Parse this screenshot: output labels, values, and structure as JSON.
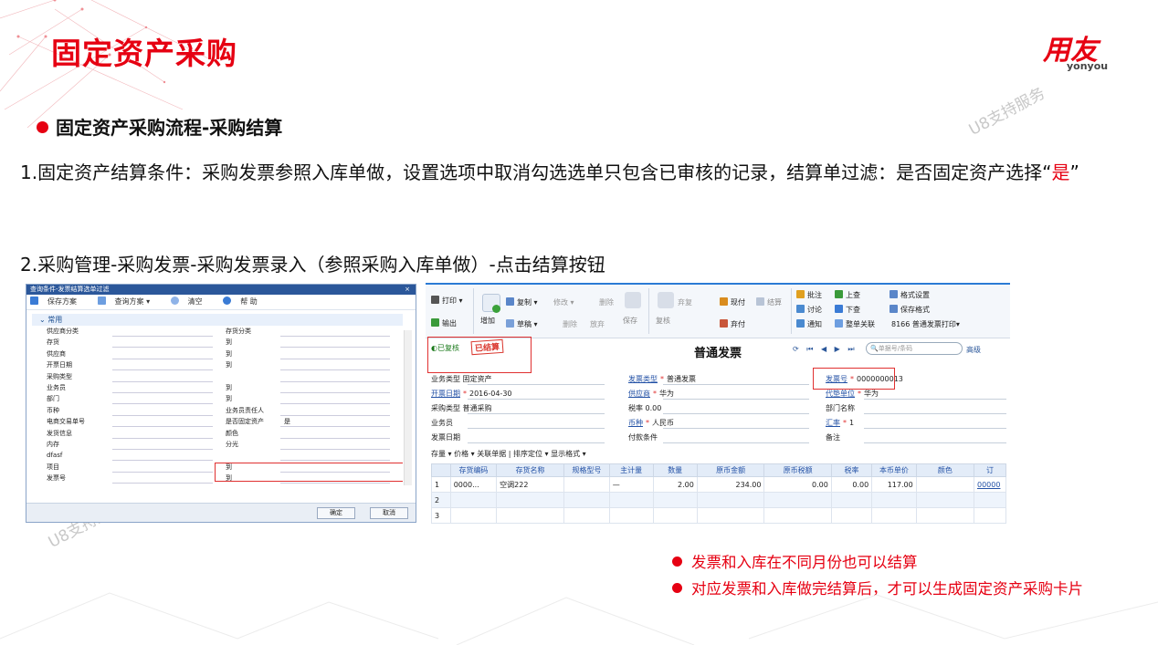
{
  "slide": {
    "title": "固定资产采购",
    "logo_cn": "用友",
    "logo_en": "yonyou",
    "section": "固定资产采购流程-采购结算",
    "para1_text": "1.固定资产结算条件：采购发票参照入库单做，设置选项中取消勾选选单只包含已审核的记录，结算单过滤：是否固定资产选择“",
    "para1_red": "是",
    "para1_end": "”",
    "para2": "2.采购管理-采购发票-采购发票录入（参照采购入库单做）-点击结算按钮",
    "watermark": "U8支持服务",
    "notes": [
      "发票和入库在不同月份也可以结算",
      "对应发票和入库做完结算后，才可以生成固定资产采购卡片"
    ]
  },
  "dialog": {
    "title": "查询条件-发票结算选单过滤",
    "close": "×",
    "toolbar": [
      "保存方案",
      "查询方案 ▾",
      "清空",
      "帮 助"
    ],
    "group": "常用",
    "fields_left": [
      "供应商分类",
      "存货",
      "供应商",
      "开票日期",
      "采购类型",
      "业务员",
      "部门",
      "币种",
      "电商交易单号",
      "发货信息",
      "内存",
      "dfasf",
      "项目",
      "发票号"
    ],
    "fields_right": [
      "存货分类",
      "到",
      "到",
      "到",
      "",
      "到",
      "到",
      "业务员责任人",
      "是否固定资产",
      "颜色",
      "分光",
      "",
      "到",
      "到"
    ],
    "fixed_asset_value": "是",
    "ok": "确定",
    "cancel": "取消"
  },
  "window": {
    "toolbar": {
      "print": "打印 ▾",
      "export": "输出",
      "add": "增加",
      "copy": "复制 ▾",
      "draft": "草稿 ▾",
      "modify": "修改 ▾",
      "delete": "删除",
      "delete2": "删除",
      "abandon": "放弃",
      "save": "保存",
      "audit": "复核",
      "unaudit": "弃复",
      "cash": "现付",
      "settle": "结算",
      "abandon_pay": "弃付",
      "approve": "批注",
      "discuss": "讨论",
      "notify": "通知",
      "prev": "上查",
      "next": "下查",
      "whole": "整单关联",
      "fmt_set": "格式设置",
      "fmt_save": "保存格式",
      "print_tpl": "8166 普通发票打印▾"
    },
    "status": "已复核",
    "stamp": "已结算",
    "doc_title": "普通发票",
    "nav": "⟳ ⏮ ◀ ▶ ⏭",
    "search_placeholder": "单据号/条码",
    "advanced": "高级",
    "header": {
      "biz_type_label": "业务类型",
      "biz_type": "固定资产",
      "inv_type_label": "发票类型",
      "inv_type": "普通发票",
      "inv_no_label": "发票号",
      "inv_no": "0000000013",
      "inv_date_label": "开票日期",
      "inv_date": "2016-04-30",
      "supplier_label": "供应商",
      "supplier": "华为",
      "agent_label": "代垫单位",
      "agent": "华为",
      "purch_type_label": "采购类型",
      "purch_type": "普通采购",
      "tax_rate_label": "税率",
      "tax_rate": "0.00",
      "dept_label": "部门名称",
      "dept": "",
      "salesman_label": "业务员",
      "salesman": "",
      "currency_label": "币种",
      "currency": "人民币",
      "exrate_label": "汇率",
      "exrate": "1",
      "ship_date_label": "发票日期",
      "ship_date": "",
      "pay_terms_label": "付款条件",
      "pay_terms": "",
      "remark_label": "备注",
      "remark": ""
    },
    "grid_toolbar": "存量 ▾  价格 ▾   关联单据  |  排序定位 ▾  显示格式 ▾",
    "grid_columns": [
      "",
      "存货编码",
      "存货名称",
      "规格型号",
      "主计量",
      "数量",
      "原币金额",
      "原币税额",
      "税率",
      "本币单价",
      "颜色",
      "订"
    ],
    "grid_rows": [
      [
        "1",
        "0000...",
        "空调222",
        "",
        "—",
        "2.00",
        "234.00",
        "0.00",
        "0.00",
        "117.00",
        "",
        "00000"
      ],
      [
        "2",
        "",
        "",
        "",
        "",
        "",
        "",
        "",
        "",
        "",
        "",
        ""
      ],
      [
        "3",
        "",
        "",
        "",
        "",
        "",
        "",
        "",
        "",
        "",
        "",
        ""
      ]
    ]
  },
  "colors": {
    "brand_red": "#e60012",
    "accent_blue": "#2b579a"
  }
}
